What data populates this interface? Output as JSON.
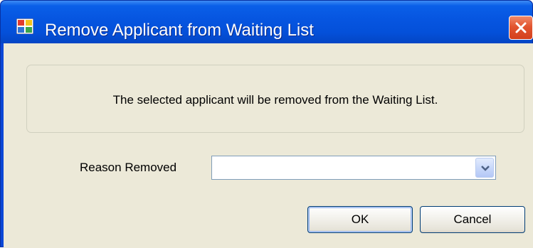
{
  "window": {
    "title": "Remove Applicant from Waiting List",
    "icon": "application-icon",
    "close_icon": "close-icon"
  },
  "dialog": {
    "message": "The selected applicant will be removed from the Waiting List.",
    "reason_label": "Reason Removed",
    "reason_value": "",
    "dropdown_icon": "chevron-down-icon"
  },
  "buttons": {
    "ok_label": "OK",
    "cancel_label": "Cancel"
  },
  "colors": {
    "titlebar": "#0655e0",
    "client_background": "#ece9d8",
    "close_button": "#e2552f",
    "button_border": "#003c74"
  }
}
